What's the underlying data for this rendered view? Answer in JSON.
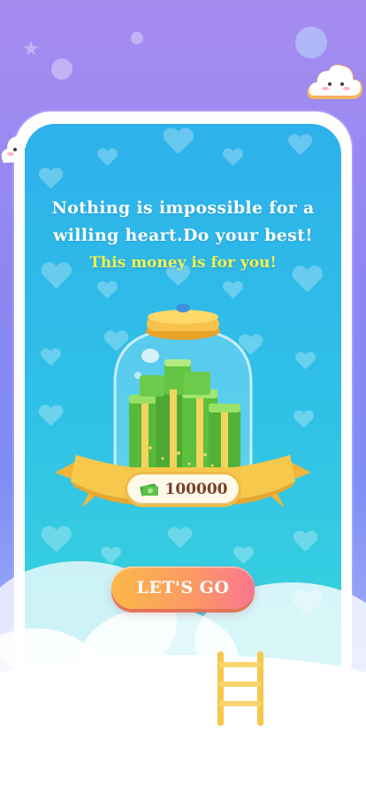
{
  "message": {
    "line1": "Nothing is impossible for a",
    "line2": "willing heart.Do your best!",
    "highlight": "This money is for you!"
  },
  "reward": {
    "amount": "100000",
    "icon": "cash-stack-icon"
  },
  "cta": {
    "label": "LET'S GO"
  },
  "colors": {
    "background_top": "#a78cf0",
    "panel": "#2fbfe8",
    "highlight_text": "#f4f34d",
    "button_start": "#fbb84a",
    "button_end": "#f97690",
    "ribbon": "#f6c84c"
  }
}
